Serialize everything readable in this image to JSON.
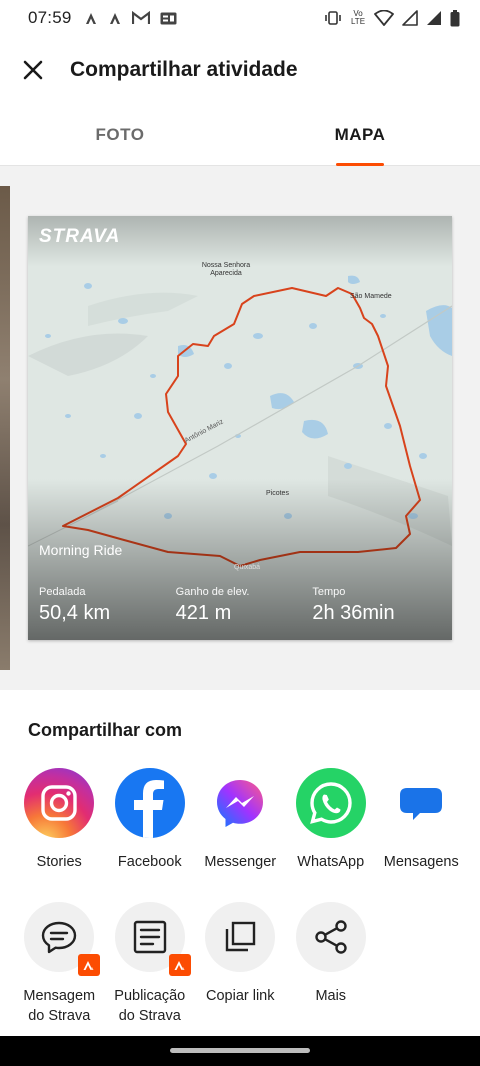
{
  "status_bar": {
    "time": "07:59",
    "left_icons": [
      "strava-notification-icon",
      "strava-notification-icon",
      "gmail-icon",
      "news-icon"
    ],
    "right_icons": [
      "vibrate-icon",
      "volte-icon",
      "wifi-icon",
      "signal-icon",
      "signal-icon",
      "battery-icon"
    ],
    "volte_text": "Vo LTE"
  },
  "header": {
    "close_icon": "close-icon",
    "title": "Compartilhar atividade"
  },
  "tabs": [
    {
      "label": "FOTO",
      "active": false
    },
    {
      "label": "MAPA",
      "active": true
    }
  ],
  "map_card": {
    "logo": "STRAVA",
    "activity_name": "Morning Ride",
    "places": [
      "Nossa Senhora Aparecida",
      "São Mamede",
      "Antônio Mariz",
      "Picotes",
      "Quixabá"
    ],
    "stats": [
      {
        "label": "Pedalada",
        "value": "50,4 km"
      },
      {
        "label": "Ganho de elev.",
        "value": "421 m"
      },
      {
        "label": "Tempo",
        "value": "2h 36min"
      }
    ]
  },
  "share": {
    "title": "Compartilhar com",
    "apps": [
      {
        "label": "Stories",
        "icon": "instagram-icon"
      },
      {
        "label": "Facebook",
        "icon": "facebook-icon"
      },
      {
        "label": "Messenger",
        "icon": "messenger-icon"
      },
      {
        "label": "WhatsApp",
        "icon": "whatsapp-icon"
      },
      {
        "label": "Mensagens",
        "icon": "messages-icon"
      }
    ],
    "actions": [
      {
        "label_line1": "Mensagem",
        "label_line2": "do Strava",
        "icon": "chat-bubble-icon"
      },
      {
        "label_line1": "Publicação",
        "label_line2": "do Strava",
        "icon": "post-icon"
      },
      {
        "label_line1": "Copiar link",
        "label_line2": "",
        "icon": "copy-icon"
      },
      {
        "label_line1": "Mais",
        "label_line2": "",
        "icon": "share-icon"
      }
    ]
  },
  "colors": {
    "accent": "#fc4c02",
    "route": "#d8431c"
  }
}
